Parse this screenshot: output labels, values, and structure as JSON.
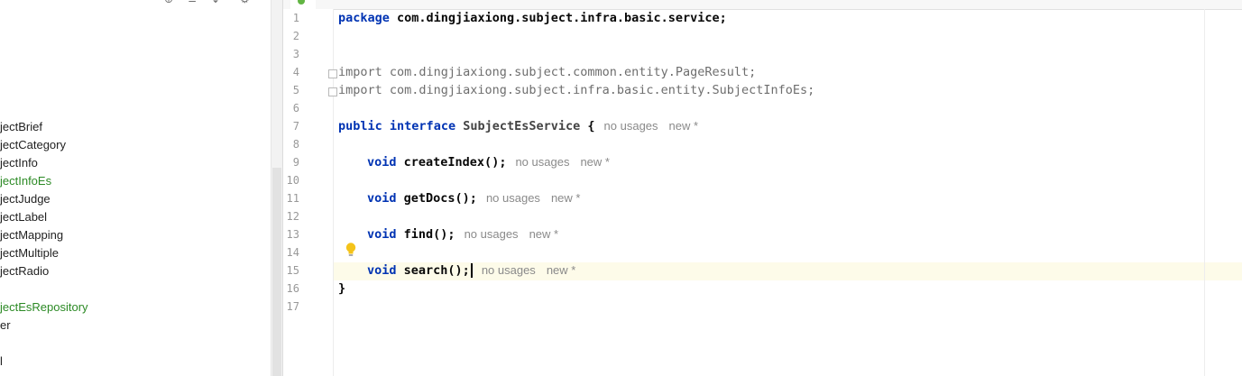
{
  "tree": {
    "items": [
      {
        "label": "jectBrief",
        "color": "default"
      },
      {
        "label": "jectCategory",
        "color": "default"
      },
      {
        "label": "jectInfo",
        "color": "default"
      },
      {
        "label": "jectInfoEs",
        "color": "#2c8a25"
      },
      {
        "label": "jectJudge",
        "color": "default"
      },
      {
        "label": "jectLabel",
        "color": "default"
      },
      {
        "label": "jectMapping",
        "color": "default"
      },
      {
        "label": "jectMultiple",
        "color": "default"
      },
      {
        "label": "jectRadio",
        "color": "default"
      },
      {
        "label": "",
        "color": "default"
      },
      {
        "label": "jectEsRepository",
        "color": "#2c8a25"
      },
      {
        "label": "er",
        "color": "default"
      },
      {
        "label": "",
        "color": "default"
      },
      {
        "label": "l",
        "color": "default"
      }
    ]
  },
  "editor": {
    "line_numbers": [
      "1",
      "2",
      "3",
      "4",
      "5",
      "6",
      "7",
      "8",
      "9",
      "10",
      "11",
      "12",
      "13",
      "14",
      "15",
      "16",
      "17"
    ],
    "hints": {
      "usages": "no usages",
      "new": "new *"
    },
    "code": {
      "l1": {
        "kw": "package",
        "rest": " com.dingjiaxiong.subject.infra.basic.service;"
      },
      "l4": "import com.dingjiaxiong.subject.common.entity.PageResult;",
      "l5": "import com.dingjiaxiong.subject.infra.basic.entity.SubjectInfoEs;",
      "l7": {
        "kw1": "public",
        "kw2": "interface",
        "name": "SubjectEsService",
        "brace": "{"
      },
      "l9": {
        "kw": "void",
        "method": "createIndex();"
      },
      "l11": {
        "kw": "void",
        "method": "getDocs();"
      },
      "l13": {
        "kw": "void",
        "method": "find();"
      },
      "l15": {
        "kw": "void",
        "method": "search();"
      },
      "l16": "}"
    },
    "current_line": 15,
    "accent_colors": {
      "keyword": "#0033b3",
      "green_file": "#2c8a25",
      "current_line": "#fdfbe9"
    }
  }
}
